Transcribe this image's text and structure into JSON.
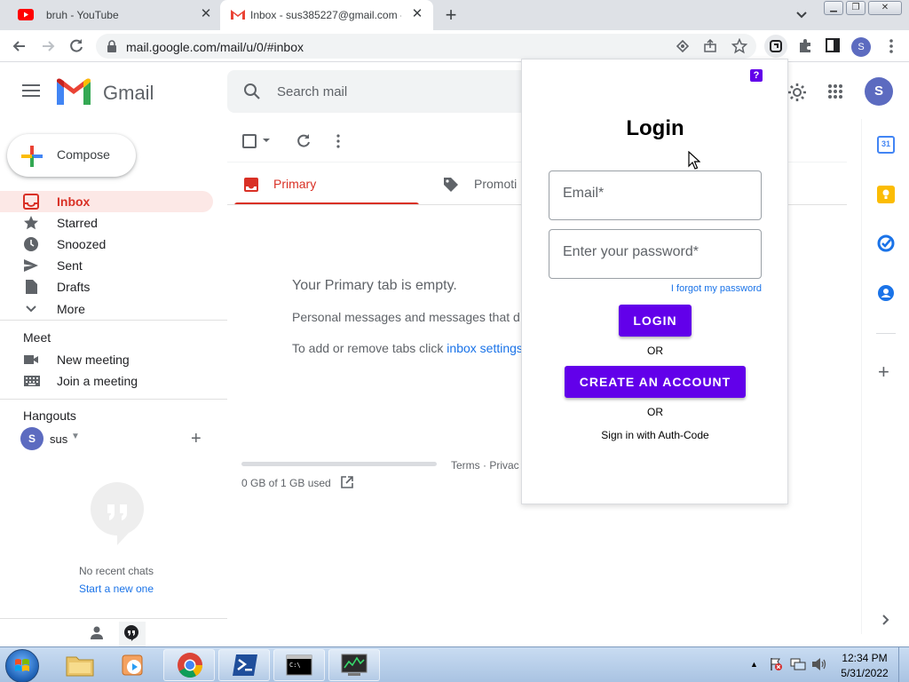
{
  "browser": {
    "tabs": [
      {
        "title": "bruh - YouTube"
      },
      {
        "title": "Inbox - sus385227@gmail.com -"
      }
    ],
    "url": "mail.google.com/mail/u/0/#inbox",
    "profile_initial": "S"
  },
  "gmail": {
    "brand": "Gmail",
    "search_placeholder": "Search mail",
    "account_initial": "S",
    "compose_label": "Compose",
    "nav": [
      {
        "label": "Inbox"
      },
      {
        "label": "Starred"
      },
      {
        "label": "Snoozed"
      },
      {
        "label": "Sent"
      },
      {
        "label": "Drafts"
      },
      {
        "label": "More"
      }
    ],
    "meet": {
      "heading": "Meet",
      "items": [
        "New meeting",
        "Join a meeting"
      ]
    },
    "hangouts": {
      "heading": "Hangouts",
      "user_initial": "S",
      "user_name": "sus",
      "no_chats": "No recent chats",
      "start_chat": "Start a new one"
    },
    "tabs": [
      "Primary",
      "Promoti"
    ],
    "empty": {
      "title": "Your Primary tab is empty.",
      "line1": "Personal messages and messages that d",
      "line2_prefix": "To add or remove tabs click ",
      "line2_link": "inbox settings"
    },
    "storage": "0 GB of 1 GB used",
    "footer_links": "Terms · Privac",
    "calendar_day": "31"
  },
  "login_popup": {
    "help_icon": "?",
    "title": "Login",
    "email_placeholder": "Email*",
    "password_placeholder": "Enter your password*",
    "forgot": "I forgot my password",
    "login_button": "LOGIN",
    "or1": "OR",
    "create_button": "CREATE AN ACCOUNT",
    "or2": "OR",
    "auth_code": "Sign in with Auth-Code"
  },
  "taskbar": {
    "time": "12:34 PM",
    "date": "5/31/2022"
  },
  "colors": {
    "gmail_red": "#d93025",
    "popup_purple": "#6200ea",
    "link_blue": "#1a73e8"
  }
}
